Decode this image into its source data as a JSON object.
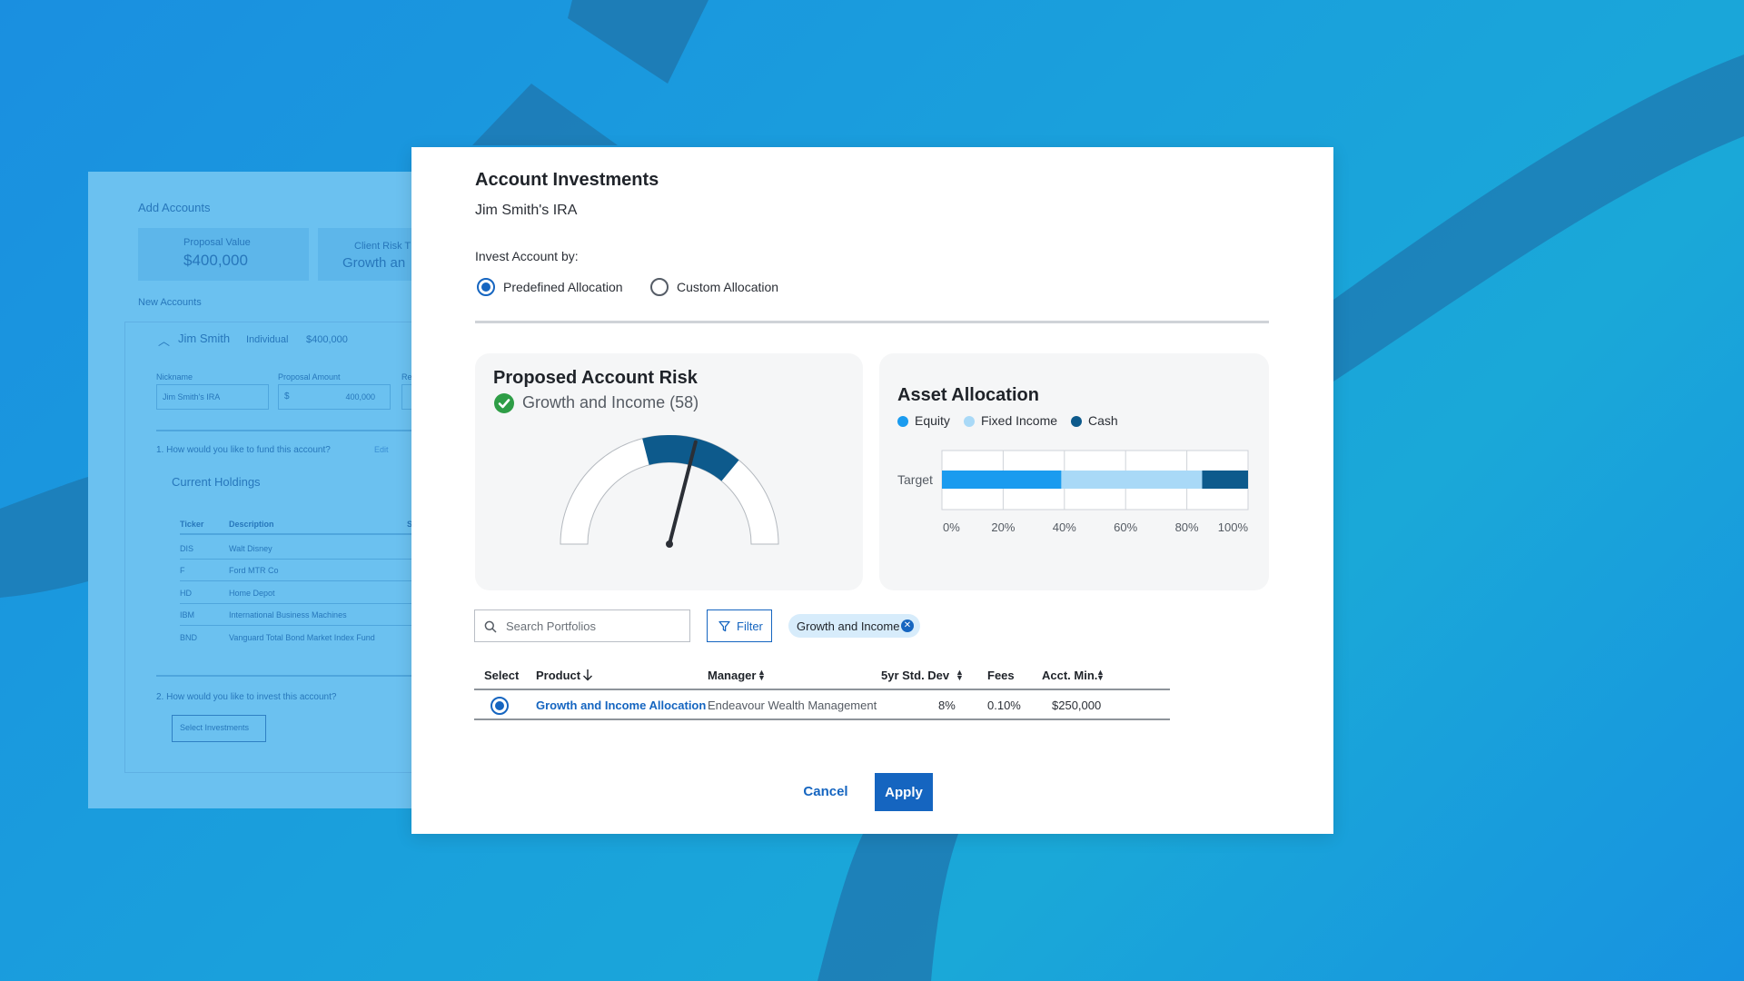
{
  "background_panel": {
    "title": "Add Accounts",
    "proposal_value_label": "Proposal Value",
    "proposal_value": "$400,000",
    "client_risk_label": "Client Risk T",
    "client_risk_value": "Growth an",
    "new_accounts_label": "New Accounts",
    "account_name": "Jim Smith",
    "account_type": "Individual",
    "account_amount": "$400,000",
    "nickname_label": "Nickname",
    "nickname_value": "Jim Smith's IRA",
    "proposal_amount_label": "Proposal Amount",
    "proposal_amount_currency": "$",
    "proposal_amount_value": "400,000",
    "third_col_label": "Re",
    "question1": "1. How would you like to fund this account?",
    "edit_link": "Edit",
    "current_holdings_title": "Current Holdings",
    "holdings_headers": [
      "Ticker",
      "Description",
      "S"
    ],
    "holdings": [
      {
        "ticker": "DIS",
        "description": "Walt Disney"
      },
      {
        "ticker": "F",
        "description": "Ford MTR Co"
      },
      {
        "ticker": "HD",
        "description": "Home Depot"
      },
      {
        "ticker": "IBM",
        "description": "International Business Machines"
      },
      {
        "ticker": "BND",
        "description": "Vanguard Total Bond Market Index Fund"
      }
    ],
    "question2": "2. How would you like to invest this account?",
    "select_investments_label": "Select Investments"
  },
  "modal": {
    "title": "Account Investments",
    "subtitle": "Jim Smith's IRA",
    "invest_by_label": "Invest Account by:",
    "options": [
      {
        "label": "Predefined Allocation",
        "selected": true
      },
      {
        "label": "Custom Allocation",
        "selected": false
      }
    ],
    "risk": {
      "title": "Proposed Account Risk",
      "value": "Growth and Income (58)",
      "gauge_score": 58,
      "gauge_max": 100,
      "band": [
        42,
        72
      ]
    },
    "allocation": {
      "title": "Asset Allocation",
      "legend": [
        {
          "label": "Equity",
          "color": "#1a9bef"
        },
        {
          "label": "Fixed Income",
          "color": "#a9d9f7"
        },
        {
          "label": "Cash",
          "color": "#0d5a8c"
        }
      ],
      "row_label": "Target",
      "ticks": [
        "0%",
        "20%",
        "40%",
        "60%",
        "80%",
        "100%"
      ]
    },
    "search_placeholder": "Search Portfolios",
    "filter_label": "Filter",
    "chip_label": "Growth and Income",
    "table": {
      "headers": {
        "select": "Select",
        "product": "Product",
        "manager": "Manager",
        "std_dev": "5yr Std. Dev",
        "fees": "Fees",
        "acct_min": "Acct. Min."
      },
      "rows": [
        {
          "product": "Growth and Income Allocation",
          "manager": "Endeavour Wealth Management",
          "std_dev": "8%",
          "fees": "0.10%",
          "acct_min": "$250,000",
          "selected": true
        }
      ]
    },
    "cancel_label": "Cancel",
    "apply_label": "Apply"
  },
  "colors": {
    "accent": "#1565c0",
    "success": "#2e9d46",
    "gauge_band": "#0d5a8c"
  },
  "chart_data": {
    "type": "bar",
    "orientation": "horizontal-stacked",
    "title": "Asset Allocation",
    "categories": [
      "Target"
    ],
    "series": [
      {
        "name": "Equity",
        "values": [
          39
        ]
      },
      {
        "name": "Fixed Income",
        "values": [
          46
        ]
      },
      {
        "name": "Cash",
        "values": [
          15
        ]
      }
    ],
    "xlim": [
      0,
      100
    ],
    "xticks": [
      "0%",
      "20%",
      "40%",
      "60%",
      "80%",
      "100%"
    ],
    "grid": true,
    "legend": "top-left"
  }
}
